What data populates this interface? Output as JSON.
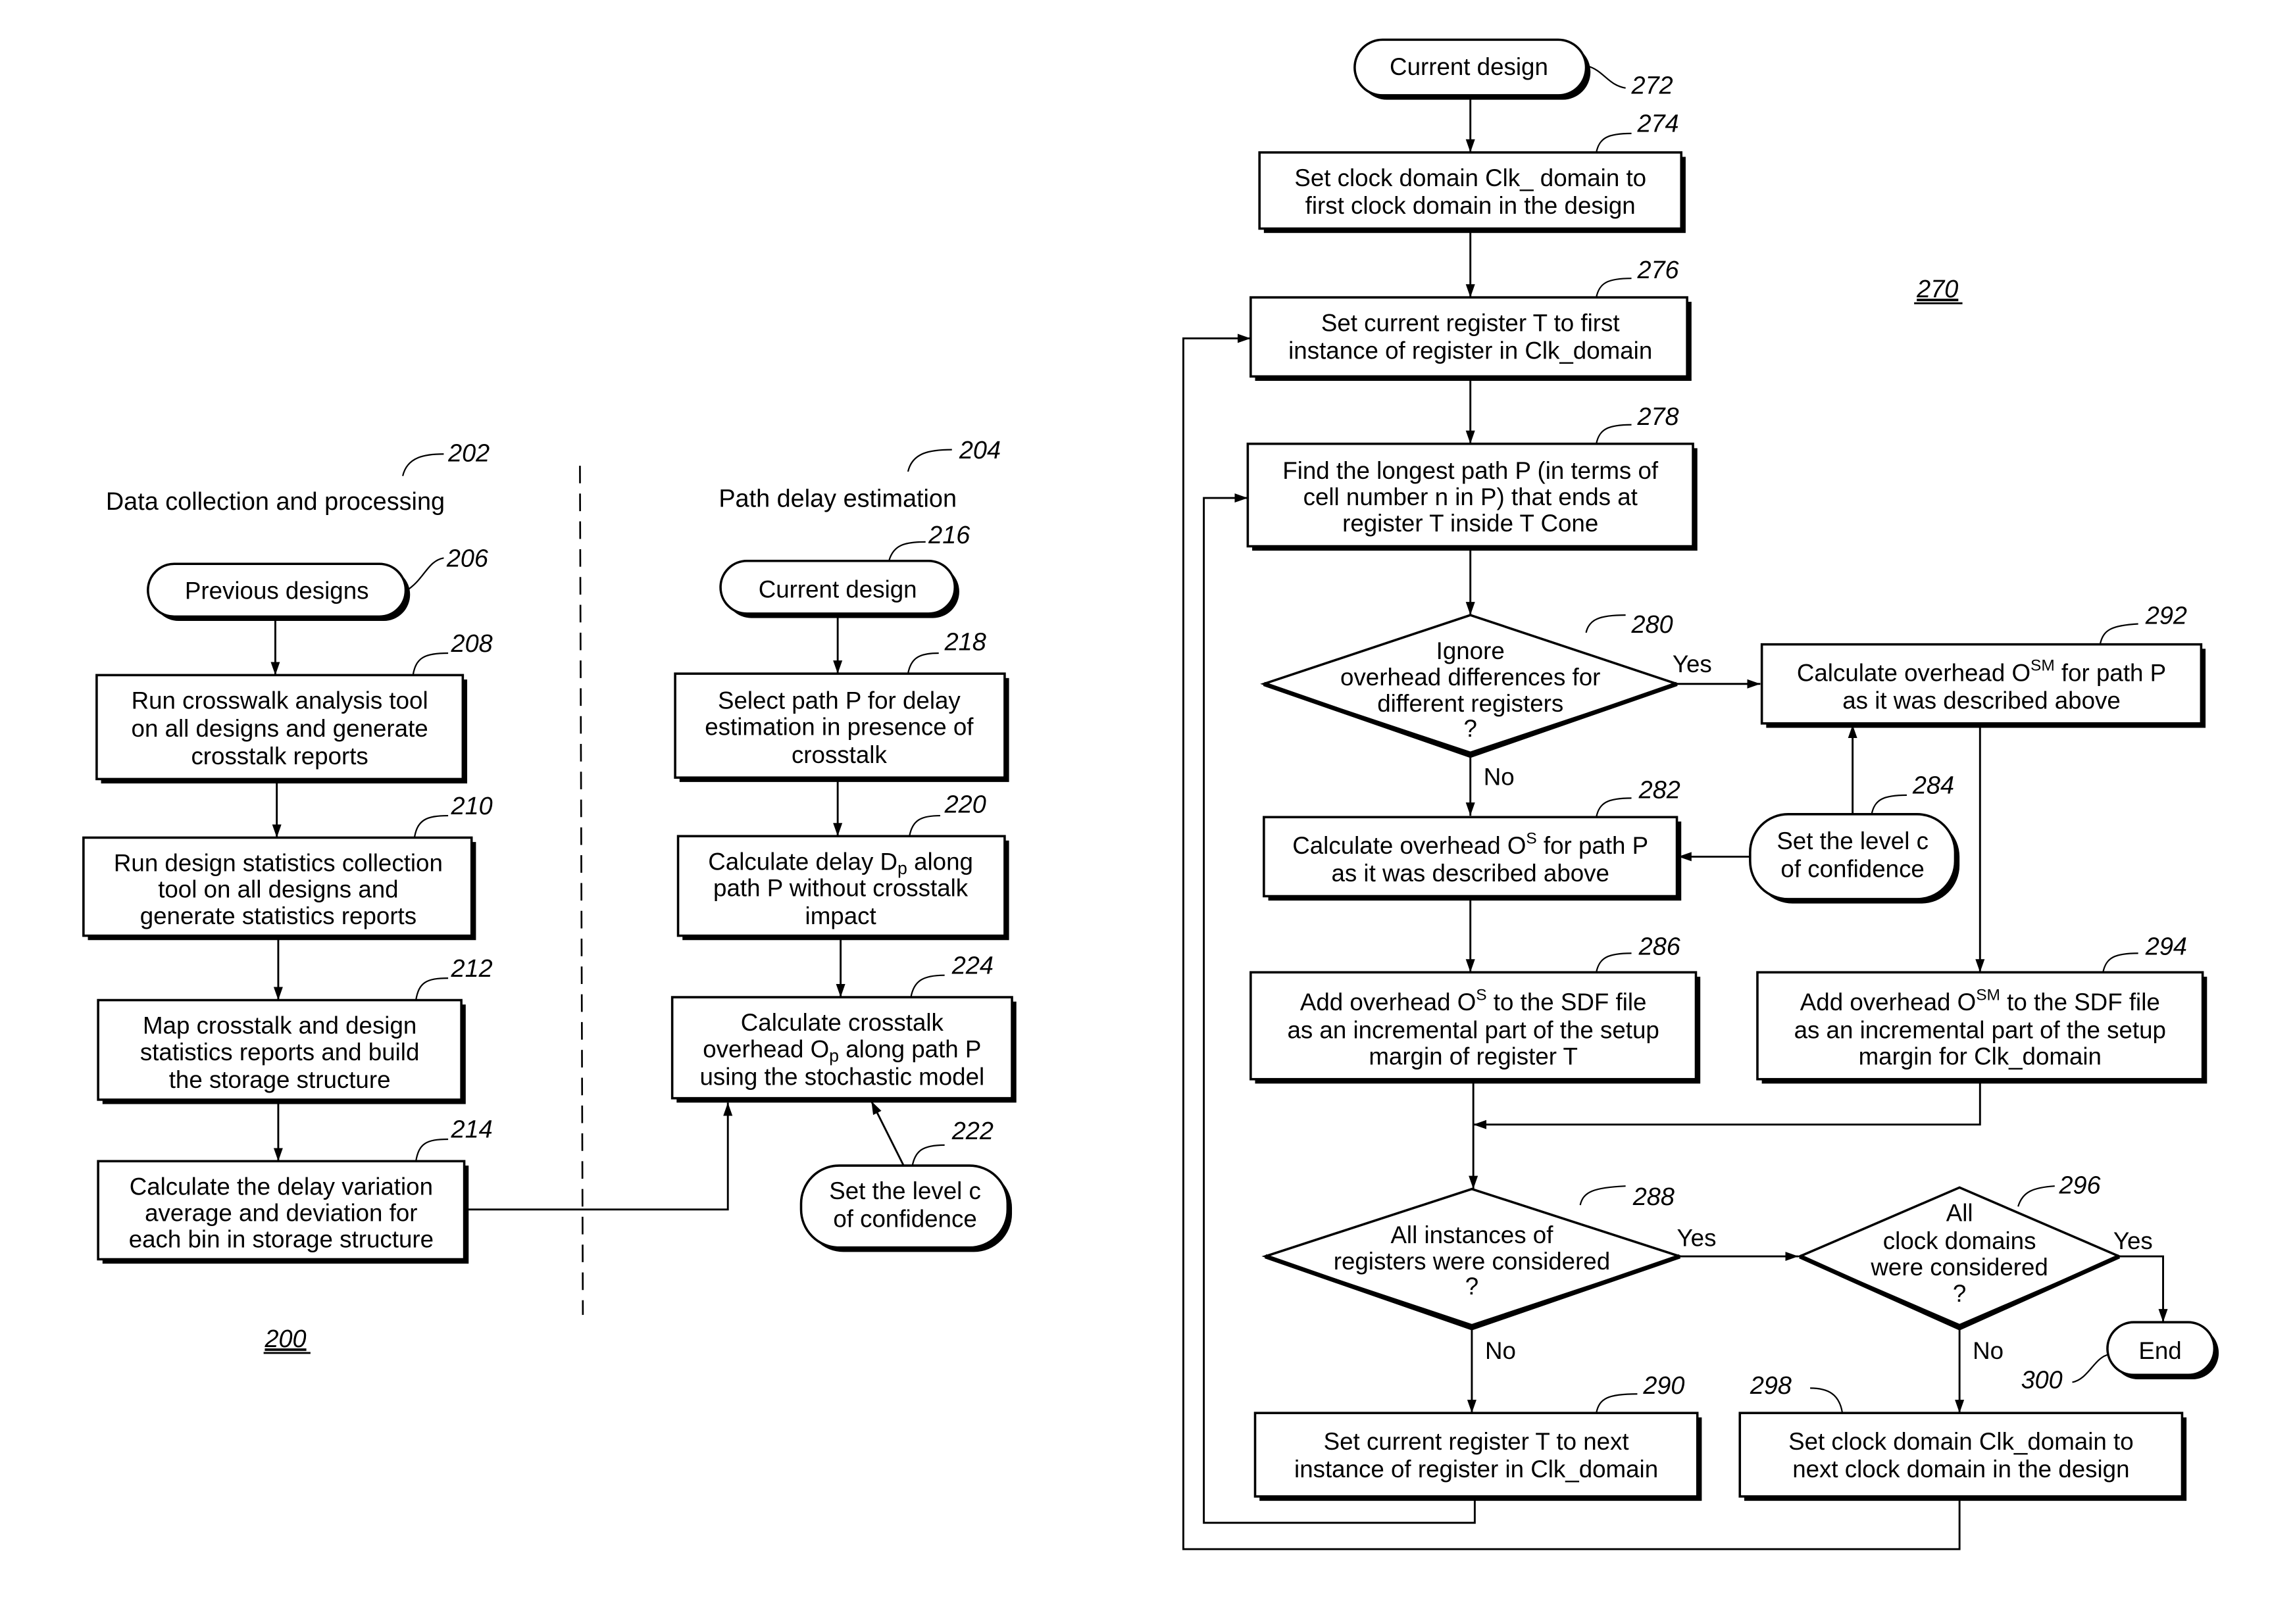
{
  "figure": {
    "left_figure_number": "200",
    "right_figure_number": "270"
  },
  "sections": {
    "data_collection": {
      "title": "Data collection and processing",
      "ref": "202"
    },
    "path_delay": {
      "title": "Path delay estimation",
      "ref": "204"
    }
  },
  "left_flow": {
    "n206": {
      "ref": "206",
      "lines": [
        "Previous designs"
      ]
    },
    "n208": {
      "ref": "208",
      "lines": [
        "Run crosswalk analysis tool",
        "on all designs and generate",
        "crosstalk reports"
      ]
    },
    "n210": {
      "ref": "210",
      "lines": [
        "Run design statistics collection",
        "tool on all designs and",
        "generate statistics reports"
      ]
    },
    "n212": {
      "ref": "212",
      "lines": [
        "Map crosstalk and design",
        "statistics reports and build",
        "the storage structure"
      ]
    },
    "n214": {
      "ref": "214",
      "lines": [
        "Calculate the delay variation",
        "average and deviation for",
        "each bin in storage structure"
      ]
    }
  },
  "middle_flow": {
    "n216": {
      "ref": "216",
      "lines": [
        "Current design"
      ]
    },
    "n218": {
      "ref": "218",
      "lines": [
        "Select path P for delay",
        "estimation in presence of",
        "crosstalk"
      ]
    },
    "n220": {
      "ref": "220",
      "line1_pre": "Calculate delay D",
      "line1_sub": "p",
      "line1_post": " along",
      "lines_rest": [
        "path P without crosstalk",
        "impact"
      ]
    },
    "n224": {
      "ref": "224",
      "line1": "Calculate crosstalk",
      "line2_pre": "overhead O",
      "line2_sub": "p",
      "line2_post": " along path P",
      "line3": "using the stochastic model"
    },
    "n222": {
      "ref": "222",
      "lines": [
        "Set the level c",
        "of confidence"
      ]
    }
  },
  "right_flow": {
    "n272": {
      "ref": "272",
      "lines": [
        "Current design"
      ]
    },
    "n274": {
      "ref": "274",
      "lines": [
        "Set clock domain Clk_ domain to",
        "first clock domain in the design"
      ]
    },
    "n276": {
      "ref": "276",
      "lines": [
        "Set current register T to first",
        "instance of register in Clk_domain"
      ]
    },
    "n278": {
      "ref": "278",
      "lines": [
        "Find the longest path P (in terms of",
        "cell number n in P) that ends at",
        "register T inside T Cone"
      ]
    },
    "n280": {
      "ref": "280",
      "lines": [
        "Ignore",
        "overhead differences for",
        "different registers",
        "?"
      ]
    },
    "n282": {
      "ref": "282",
      "line1_pre": "Calculate overhead O",
      "line1_sup": "S",
      "line1_post": " for path P",
      "line2": "as it was described above"
    },
    "n284": {
      "ref": "284",
      "lines": [
        "Set the level c",
        "of confidence"
      ]
    },
    "n286": {
      "ref": "286",
      "line1_pre": "Add overhead O",
      "line1_sup": "S",
      "line1_post": " to the SDF file",
      "line2": "as an incremental part of the setup",
      "line3": "margin of register T"
    },
    "n292": {
      "ref": "292",
      "line1_pre": "Calculate overhead O",
      "line1_sup": "SM",
      "line1_post": " for path P",
      "line2": "as it was described above"
    },
    "n294": {
      "ref": "294",
      "line1_pre": "Add overhead O",
      "line1_sup": "SM",
      "line1_post": " to the SDF file",
      "line2": "as an incremental part of the setup",
      "line3": "margin for Clk_domain"
    },
    "n288": {
      "ref": "288",
      "lines": [
        "All instances of",
        "registers were considered",
        "?"
      ]
    },
    "n296": {
      "ref": "296",
      "lines": [
        "All",
        "clock domains",
        "were considered",
        "?"
      ]
    },
    "n290": {
      "ref": "290",
      "lines": [
        "Set current register T to next",
        "instance of register in Clk_domain"
      ]
    },
    "n298": {
      "ref": "298",
      "lines": [
        "Set clock domain Clk_domain to",
        "next clock domain in the design"
      ]
    },
    "n300": {
      "ref": "300",
      "lines": [
        "End"
      ]
    }
  },
  "branch_labels": {
    "yes": "Yes",
    "no": "No"
  }
}
